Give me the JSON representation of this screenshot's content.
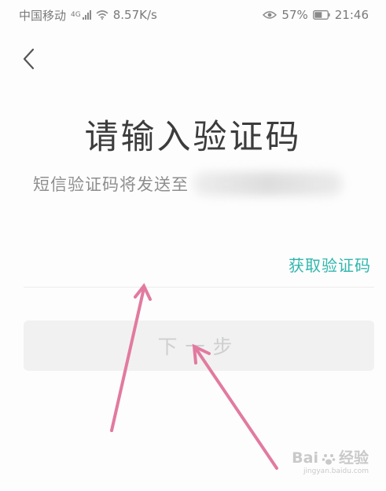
{
  "status_bar": {
    "carrier": "中国移动",
    "network": "4G",
    "speed": "8.57K/s",
    "battery": "57%",
    "time": "21:46"
  },
  "page": {
    "title": "请输入验证码",
    "subtitle": "短信验证码将发送至",
    "code_placeholder": "",
    "get_code_label": "获取验证码",
    "next_label": "下一步"
  },
  "watermark": {
    "brand": "Bai",
    "brand_suffix": "经验",
    "url": "jingyan.baidu.com"
  },
  "colors": {
    "accent": "#2fb7ae",
    "arrow": "#e27aa0",
    "disabled_button": "#f1f1f1"
  }
}
